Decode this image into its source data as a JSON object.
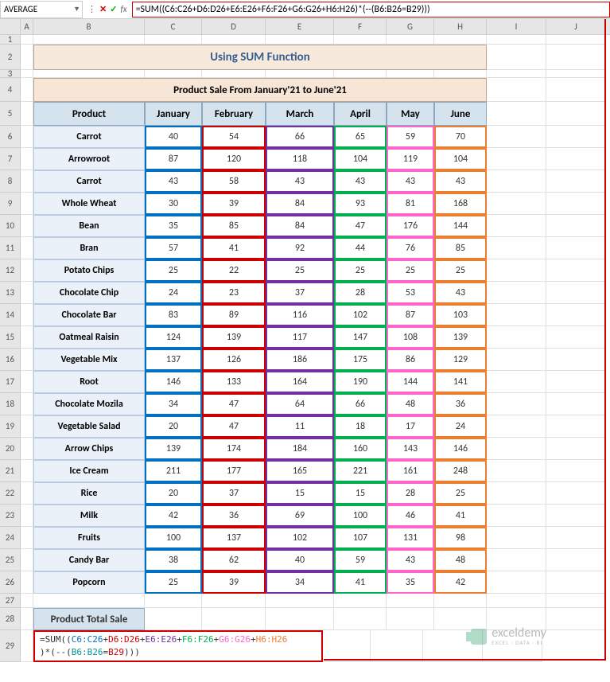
{
  "name_box": "AVERAGE",
  "formula_bar": "=SUM((C6:C26+D6:D26+E6:E26+F6:F26+G6:G26+H6:H26)*(--(B6:B26=B29)))",
  "columns": [
    "A",
    "B",
    "C",
    "D",
    "E",
    "F",
    "G",
    "H",
    "I",
    "J"
  ],
  "page_title": "Using SUM Function",
  "table_title": "Product Sale From January'21 to June'21",
  "headers": [
    "Product",
    "January",
    "February",
    "March",
    "April",
    "May",
    "June"
  ],
  "rows": [
    {
      "n": 6,
      "p": "Carrot",
      "v": [
        40,
        54,
        66,
        65,
        59,
        70
      ]
    },
    {
      "n": 7,
      "p": "Arrowroot",
      "v": [
        87,
        120,
        118,
        104,
        119,
        104
      ]
    },
    {
      "n": 8,
      "p": "Carrot",
      "v": [
        43,
        58,
        43,
        43,
        43,
        43
      ]
    },
    {
      "n": 9,
      "p": "Whole Wheat",
      "v": [
        30,
        39,
        84,
        93,
        81,
        168
      ]
    },
    {
      "n": 10,
      "p": "Bean",
      "v": [
        35,
        85,
        84,
        47,
        176,
        144
      ]
    },
    {
      "n": 11,
      "p": "Bran",
      "v": [
        57,
        41,
        92,
        44,
        76,
        85
      ]
    },
    {
      "n": 12,
      "p": "Potato Chips",
      "v": [
        25,
        22,
        25,
        25,
        25,
        25
      ]
    },
    {
      "n": 13,
      "p": "Chocolate Chip",
      "v": [
        24,
        23,
        37,
        28,
        53,
        43
      ]
    },
    {
      "n": 14,
      "p": "Chocolate Bar",
      "v": [
        83,
        89,
        116,
        102,
        87,
        103
      ]
    },
    {
      "n": 15,
      "p": "Oatmeal Raisin",
      "v": [
        124,
        139,
        117,
        147,
        108,
        139
      ]
    },
    {
      "n": 16,
      "p": "Vegetable Mix",
      "v": [
        137,
        126,
        186,
        175,
        86,
        129
      ]
    },
    {
      "n": 17,
      "p": "Root",
      "v": [
        146,
        133,
        164,
        190,
        144,
        141
      ]
    },
    {
      "n": 18,
      "p": "Chocolate Mozila",
      "v": [
        34,
        47,
        64,
        66,
        48,
        36
      ]
    },
    {
      "n": 19,
      "p": "Vegetable Salad",
      "v": [
        20,
        47,
        11,
        18,
        17,
        24
      ]
    },
    {
      "n": 20,
      "p": "Arrow Chips",
      "v": [
        139,
        174,
        184,
        160,
        143,
        146
      ]
    },
    {
      "n": 21,
      "p": "Ice Cream",
      "v": [
        211,
        177,
        165,
        221,
        161,
        248
      ]
    },
    {
      "n": 22,
      "p": "Rice",
      "v": [
        20,
        37,
        15,
        15,
        28,
        25
      ]
    },
    {
      "n": 23,
      "p": "Milk",
      "v": [
        42,
        36,
        69,
        100,
        46,
        41
      ]
    },
    {
      "n": 24,
      "p": "Fruits",
      "v": [
        100,
        137,
        102,
        107,
        131,
        98
      ]
    },
    {
      "n": 25,
      "p": "Candy Bar",
      "v": [
        38,
        62,
        40,
        59,
        43,
        48
      ]
    },
    {
      "n": 26,
      "p": "Popcorn",
      "v": [
        25,
        39,
        34,
        41,
        35,
        42
      ]
    }
  ],
  "bottom_label": "Product Total Sale",
  "cell_formula": "=SUM((C6:C26+D6:D26+E6:E26+F6:F26+G6:G26+H6:H26)*(--(B6:B26=B29)))",
  "watermark": {
    "name": "exceldemy",
    "sub": "EXCEL · DATA · BI"
  }
}
